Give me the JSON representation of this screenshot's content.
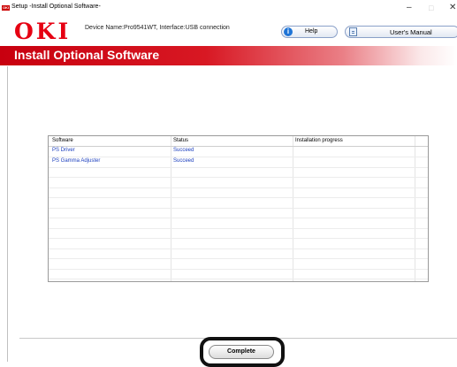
{
  "window": {
    "title": "Setup -Install Optional Software-",
    "app_icon_text": "OKI",
    "controls": {
      "minimize": "–",
      "maximize": "□",
      "close": "✕"
    }
  },
  "header": {
    "logo": "OKI",
    "device_info": "Device Name:Pro9541WT, Interface:USB connection",
    "help_label": "Help",
    "help_icon_glyph": "i",
    "manual_label": "User's Manual"
  },
  "banner": {
    "title": "Install Optional Software"
  },
  "table": {
    "columns": [
      "Software",
      "Status",
      "Installation progress"
    ],
    "rows": [
      {
        "software": "PS Driver",
        "status": "Succeed",
        "progress": ""
      },
      {
        "software": "PS Gamma Adjuster",
        "status": "Succeed",
        "progress": ""
      }
    ]
  },
  "footer": {
    "complete_label": "Complete"
  },
  "colors": {
    "brand_red": "#e60012",
    "banner_red": "#c8000f",
    "link_blue": "#1c3fbe"
  }
}
